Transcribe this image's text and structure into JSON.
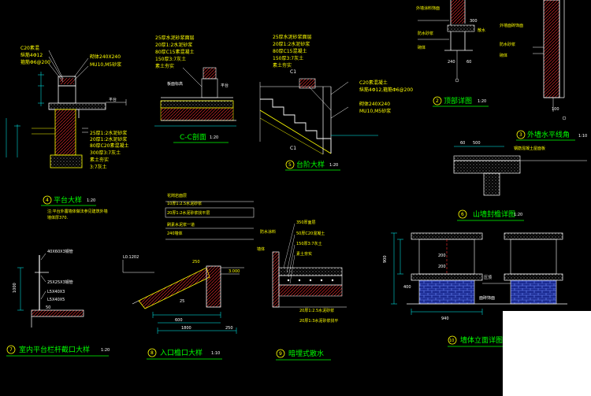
{
  "canvas": {
    "background": "#000000",
    "line_color": "#ffffff",
    "text_yellow": "#ffff00",
    "title_green": "#00ff00",
    "dim_cyan": "#00ffff",
    "hatch_red": "#ff3030",
    "brick_blue": "#4a6cff"
  },
  "platform": {
    "notes": [
      "C20素混",
      "纵筋4Φ12",
      "箍筋Φ6@200",
      "砌体240X240",
      "MU10,M5砂浆",
      "25厚1:2水泥砂浆",
      "20厚1:2水泥砂浆",
      "80厚C20素混凝土",
      "300厚3:7灰土",
      "素土夯实",
      "3:7灰土"
    ],
    "title": "平台大样",
    "num": "4",
    "scale": "1:20",
    "sub_notes": [
      "注:平台外露墙体做法参见建筑外墙",
      "墙体厚370."
    ]
  },
  "cc": {
    "notes": [
      "25厚水泥砂浆面层",
      "20厚1:2水泥砂浆",
      "80厚C15素混凝土",
      "150厚3:7灰土",
      "素土夯实"
    ],
    "title": "C-C剖面",
    "scale": "1:20"
  },
  "step": {
    "notes": [
      "25厚水泥砂浆面层",
      "20厚1:2水泥砂浆",
      "80厚C15混凝土",
      "150厚3:7灰土",
      "素土夯实",
      "C20素混凝土",
      "纵筋4Φ12,箍筋Φ6@200",
      "砌体240X240",
      "MU10,M5砂浆"
    ],
    "cut": "C1",
    "title": "台阶大样",
    "num": "5",
    "scale": "1:20"
  },
  "detail2": {
    "notes": [
      "外墙涂料饰面",
      "防水砂浆",
      "砌体",
      "散水"
    ],
    "dims": [
      "300",
      "240",
      "60"
    ],
    "title": "顶部详图",
    "num": "2",
    "scale": "1:20"
  },
  "detail3": {
    "notes": [
      "外墙面砖饰面",
      "防水砂浆",
      "砌体"
    ],
    "dim": "100",
    "title": "外墙水平线角",
    "num": "3",
    "scale": "1:10"
  },
  "detail6": {
    "dims": [
      "60",
      "500"
    ],
    "note": "钢筋混凝土屋面板",
    "title": "山墙封檐详图",
    "num": "6",
    "scale": "1:20"
  },
  "detail7": {
    "notes": [
      "40X60X3钢管",
      "25X25X3钢管",
      "L5X40X3",
      "L5X40X5"
    ],
    "dims": [
      "1000",
      "50"
    ],
    "title": "室内平台栏杆截口大样",
    "num": "7",
    "scale": "1:20"
  },
  "detail8": {
    "notes": [
      "花岗岩面层",
      "10厚1:2.5水泥砂浆",
      "20厚1:2水泥砂浆找平层",
      "刷素水泥浆一道",
      "240墙体",
      "L0.1202"
    ],
    "dims": [
      "250",
      "3.000",
      "25",
      "600",
      "1800",
      "250"
    ],
    "title": "入口檐口大样",
    "num": "8",
    "scale": "1:10"
  },
  "detail9": {
    "notes": [
      "350厚面层",
      "50厚C20混凝土",
      "150厚3:7灰土",
      "素土夯实",
      "防水涂料",
      "墙体",
      "20厚1:2.5水泥砂浆",
      "20厚1:3水泥砂浆找平"
    ],
    "title": "暗埋式散水",
    "num": "9"
  },
  "detail10": {
    "dims": [
      "900",
      "200",
      "200",
      "400",
      "940"
    ],
    "notes": [
      "压顶",
      "面砖饰面"
    ],
    "title": "墙体立面详图",
    "num": "10"
  }
}
